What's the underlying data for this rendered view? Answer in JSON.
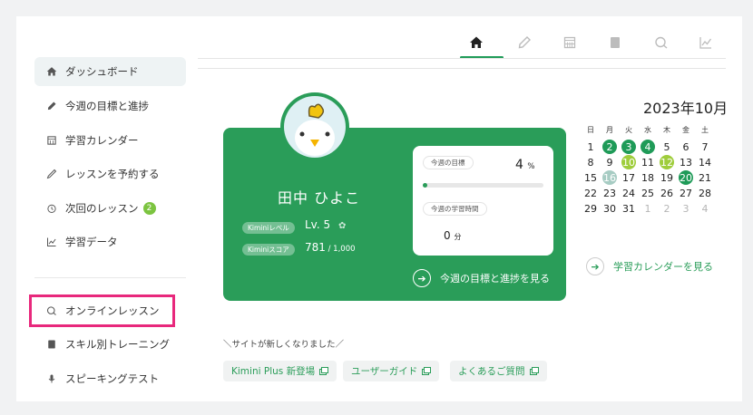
{
  "top_tabs": [
    {
      "name": "home",
      "active": true
    },
    {
      "name": "pencil",
      "active": false
    },
    {
      "name": "calendar",
      "active": false
    },
    {
      "name": "book",
      "active": false
    },
    {
      "name": "chat",
      "active": false
    },
    {
      "name": "chart",
      "active": false
    }
  ],
  "sidebar": {
    "items": [
      {
        "label": "ダッシュボード",
        "icon": "home-icon"
      },
      {
        "label": "今週の目標と進捗",
        "icon": "pencil-icon"
      },
      {
        "label": "学習カレンダー",
        "icon": "calendar-icon"
      },
      {
        "label": "レッスンを予約する",
        "icon": "pen-icon"
      },
      {
        "label": "次回のレッスン",
        "icon": "clock-icon",
        "badge": "2"
      },
      {
        "label": "学習データ",
        "icon": "chart-icon"
      },
      {
        "label": "オンラインレッスン",
        "icon": "chat-icon"
      },
      {
        "label": "スキル別トレーニング",
        "icon": "book-icon"
      },
      {
        "label": "スピーキングテスト",
        "icon": "mic-icon"
      }
    ]
  },
  "profile": {
    "name": "田中 ひよこ",
    "level_label": "Kiminiレベル",
    "level_value": "Lv. 5",
    "score_label": "Kiminiスコア",
    "score_value": "781",
    "score_max": " / 1,000",
    "goal_label": "今週の目標",
    "goal_percent": "4",
    "goal_percent_unit": "%",
    "goal_progress": 0.04,
    "study_time_label": "今週の学習時間",
    "study_time_value": "0",
    "study_time_unit": "分",
    "goal_link": "今週の目標と進捗を見る"
  },
  "calendar": {
    "title": "2023年10月",
    "weekdays": [
      "日",
      "月",
      "火",
      "水",
      "木",
      "金",
      "土"
    ],
    "weeks": [
      [
        "1",
        "2",
        "3",
        "4",
        "5",
        "6",
        "7"
      ],
      [
        "8",
        "9",
        "10",
        "11",
        "12",
        "13",
        "14"
      ],
      [
        "15",
        "16",
        "17",
        "18",
        "19",
        "20",
        "21"
      ],
      [
        "22",
        "23",
        "24",
        "25",
        "26",
        "27",
        "28"
      ],
      [
        "29",
        "30",
        "31",
        "1",
        "2",
        "3",
        "4"
      ]
    ],
    "link": "学習カレンダーを見る"
  },
  "news": {
    "heading": "＼サイトが新しくなりました／",
    "tags": [
      "Kimini Plus 新登場",
      "ユーザーガイド",
      "よくあるご質問"
    ]
  },
  "colors": {
    "brand_green": "#2a9d59",
    "highlight_pink": "#e8287c"
  }
}
